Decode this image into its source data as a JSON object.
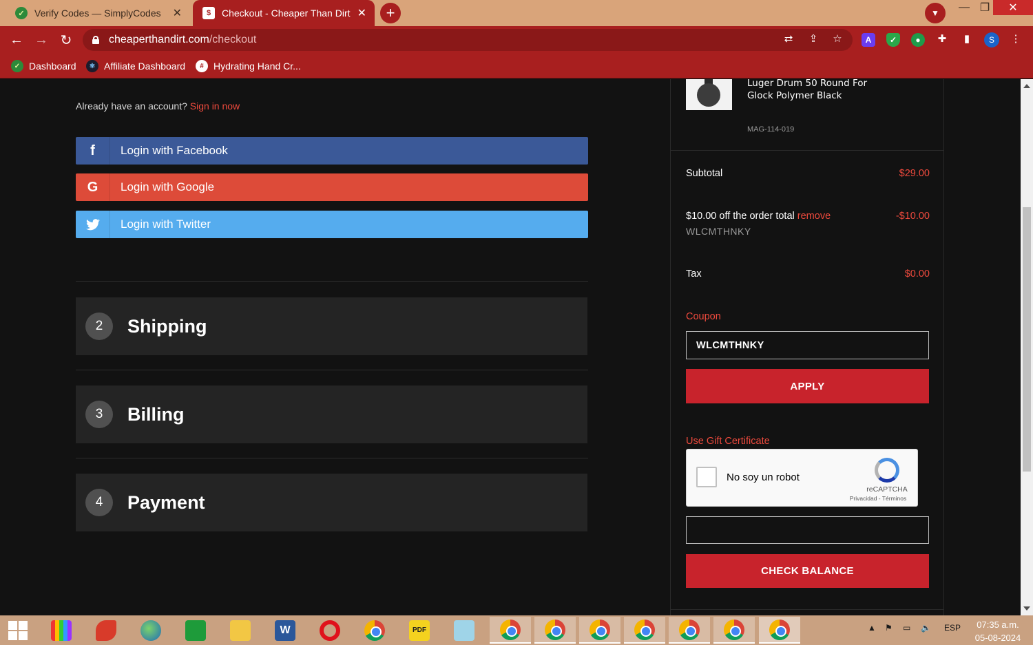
{
  "browser": {
    "tabs": [
      {
        "title": "Verify Codes — SimplyCodes",
        "active": false
      },
      {
        "title": "Checkout - Cheaper Than Dirt",
        "active": true
      }
    ],
    "url_host": "cheaperthandirt.com",
    "url_path": "/checkout",
    "bookmarks": [
      "Dashboard",
      "Affiliate Dashboard",
      "Hydrating Hand Cr..."
    ],
    "profile_initial": "S",
    "ext_a": "A"
  },
  "login": {
    "already_text": "Already have an account?",
    "sign_in_link": "Sign in now",
    "facebook": "Login with Facebook",
    "google": "Login with Google",
    "twitter": "Login with Twitter"
  },
  "steps": [
    {
      "number": "2",
      "title": "Shipping"
    },
    {
      "number": "3",
      "title": "Billing"
    },
    {
      "number": "4",
      "title": "Payment"
    }
  ],
  "summary": {
    "product_name": "Luger Drum 50 Round For Glock Polymer Black",
    "sku": "MAG-114-019",
    "subtotal_label": "Subtotal",
    "subtotal_value": "$29.00",
    "discount_label": "$10.00 off the order total",
    "discount_remove": "remove",
    "discount_value": "-$10.00",
    "discount_code": "WLCMTHNKY",
    "tax_label": "Tax",
    "tax_value": "$0.00",
    "coupon_label": "Coupon",
    "coupon_value": "WLCMTHNKY",
    "apply_label": "APPLY",
    "gift_label": "Use Gift Certificate",
    "recaptcha_label": "No soy un robot",
    "recaptcha_brand": "reCAPTCHA",
    "recaptcha_terms": "Privacidad - Términos",
    "check_balance_label": "CHECK BALANCE"
  },
  "taskbar": {
    "lang": "ESP",
    "time": "07:35 a.m.",
    "date": "05-08-2024"
  },
  "colors": {
    "brand_red": "#a81f1f",
    "accent_red": "#ef4a3d",
    "button_red": "#c8232c",
    "facebook": "#3b5998",
    "google": "#dd4b39",
    "twitter": "#55acee"
  }
}
